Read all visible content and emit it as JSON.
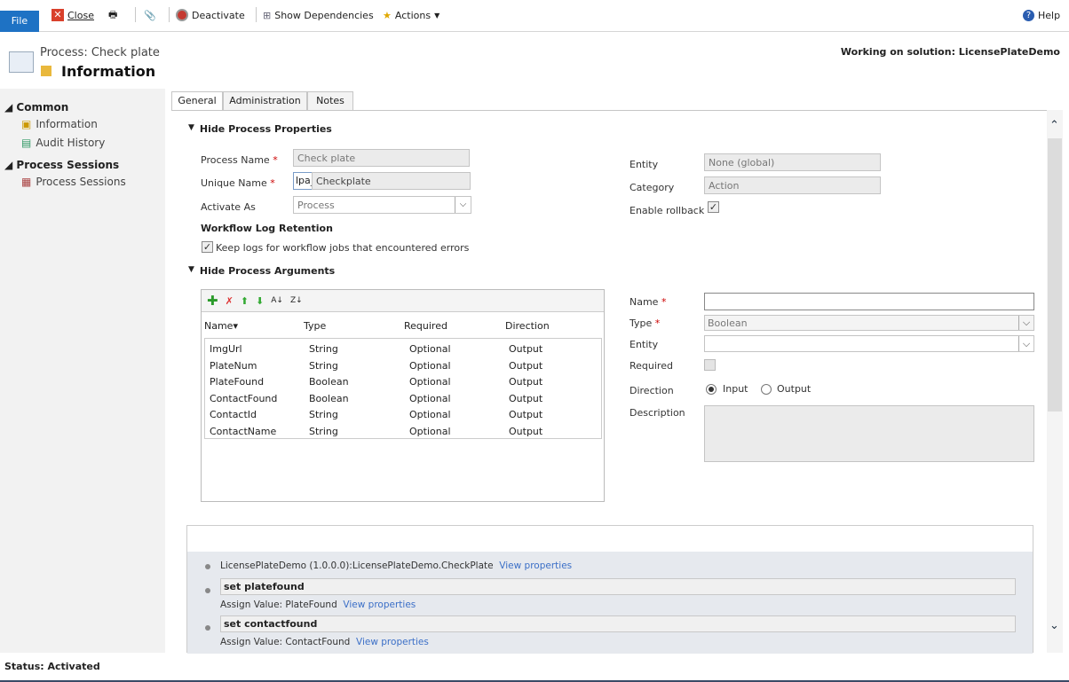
{
  "toolbar": {
    "file": "File",
    "close": "Close",
    "deactivate": "Deactivate",
    "show_dependencies": "Show Dependencies",
    "actions": "Actions",
    "help": "Help"
  },
  "header": {
    "title": "Process: Check plate",
    "subtitle": "Information",
    "solution": "Working on solution: LicensePlateDemo"
  },
  "nav": {
    "common": "Common",
    "information": "Information",
    "audit_history": "Audit History",
    "process_sessions_header": "Process Sessions",
    "process_sessions": "Process Sessions"
  },
  "tabs": [
    "General",
    "Administration",
    "Notes"
  ],
  "properties": {
    "section": "Hide Process Properties",
    "process_name_label": "Process Name",
    "process_name": "Check plate",
    "unique_name_label": "Unique Name",
    "unique_prefix": "lpa_",
    "unique_name": "Checkplate",
    "activate_as_label": "Activate As",
    "activate_as": "Process",
    "entity_label": "Entity",
    "entity": "None (global)",
    "category_label": "Category",
    "category": "Action",
    "rollback_label": "Enable rollback",
    "rollback_checked": true,
    "log_header": "Workflow Log Retention",
    "keep_logs_label": "Keep logs for workflow jobs that encountered errors",
    "keep_logs_checked": true
  },
  "arguments": {
    "section": "Hide Process Arguments",
    "columns": [
      "Name",
      "Type",
      "Required",
      "Direction"
    ],
    "rows": [
      [
        "ImgUrl",
        "String",
        "Optional",
        "Output"
      ],
      [
        "PlateNum",
        "String",
        "Optional",
        "Output"
      ],
      [
        "PlateFound",
        "Boolean",
        "Optional",
        "Output"
      ],
      [
        "ContactFound",
        "Boolean",
        "Optional",
        "Output"
      ],
      [
        "ContactId",
        "String",
        "Optional",
        "Output"
      ],
      [
        "ContactName",
        "String",
        "Optional",
        "Output"
      ]
    ],
    "form": {
      "name_label": "Name",
      "name": "",
      "type_label": "Type",
      "type": "Boolean",
      "entity_label": "Entity",
      "entity": "",
      "required_label": "Required",
      "direction_label": "Direction",
      "input": "Input",
      "output": "Output",
      "direction_selected": "Input",
      "description_label": "Description"
    }
  },
  "workflow": {
    "step0": "LicensePlateDemo (1.0.0.0):LicensePlateDemo.CheckPlate",
    "view": "View properties",
    "step1": "set platefound",
    "step1_detail": "Assign Value:  PlateFound",
    "step2": "set contactfound",
    "step2_detail": "Assign Value:  ContactFound"
  },
  "status": "Status: Activated"
}
